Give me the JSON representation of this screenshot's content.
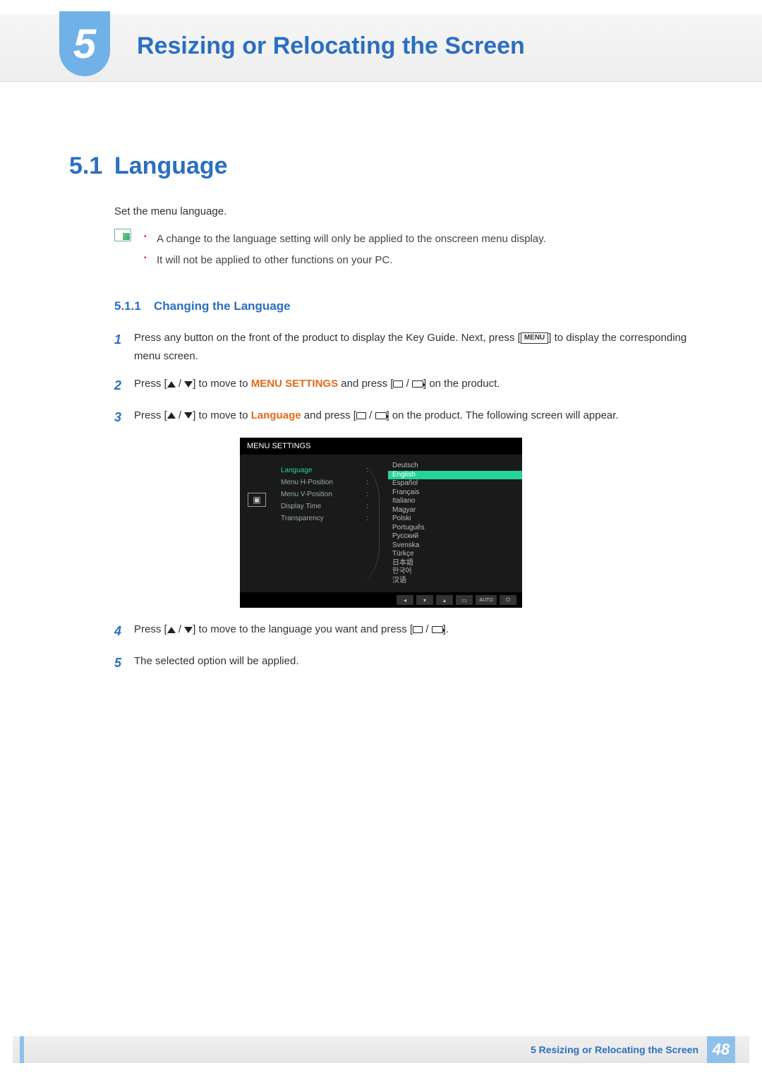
{
  "header": {
    "chapter_num": "5",
    "title": "Resizing or Relocating the Screen"
  },
  "section": {
    "num": "5.1",
    "title": "Language",
    "intro": "Set the menu language."
  },
  "notes": {
    "items": [
      "A change to the language setting will only be applied to the onscreen menu display.",
      "It will not be applied to other functions on your PC."
    ]
  },
  "subsection": {
    "num": "5.1.1",
    "title": "Changing the Language"
  },
  "steps": {
    "s1a": "Press any button on the front of the product to display the Key Guide. Next, press [",
    "s1b": "] to display the corresponding menu screen.",
    "menu_key": "MENU",
    "s2a": "Press [",
    "s2b": "] to move to ",
    "s2_target": "MENU SETTINGS",
    "s2c": " and press [",
    "s2d": "] on the product.",
    "s3a": "Press [",
    "s3b": "] to move to ",
    "s3_target": "Language",
    "s3c": " and press [",
    "s3d": "] on the product. The following screen will appear.",
    "s4a": "Press [",
    "s4b": "] to move to the language you want and press [",
    "s4c": "].",
    "s5": "The selected option will be applied.",
    "n1": "1",
    "n2": "2",
    "n3": "3",
    "n4": "4",
    "n5": "5"
  },
  "osd": {
    "title": "MENU SETTINGS",
    "menu": [
      {
        "label": "Language",
        "sel": true
      },
      {
        "label": "Menu H-Position",
        "sel": false
      },
      {
        "label": "Menu V-Position",
        "sel": false
      },
      {
        "label": "Display Time",
        "sel": false
      },
      {
        "label": "Transparency",
        "sel": false
      }
    ],
    "langs": [
      "Deutsch",
      "English",
      "Español",
      "Français",
      "Italiano",
      "Magyar",
      "Polski",
      "Português",
      "Русский",
      "Svenska",
      "Türkçe",
      "日本語",
      "한국어",
      "汉语"
    ],
    "lang_selected": "English",
    "auto": "AUTO"
  },
  "footer": {
    "caption": "5 Resizing or Relocating the Screen",
    "page": "48"
  }
}
